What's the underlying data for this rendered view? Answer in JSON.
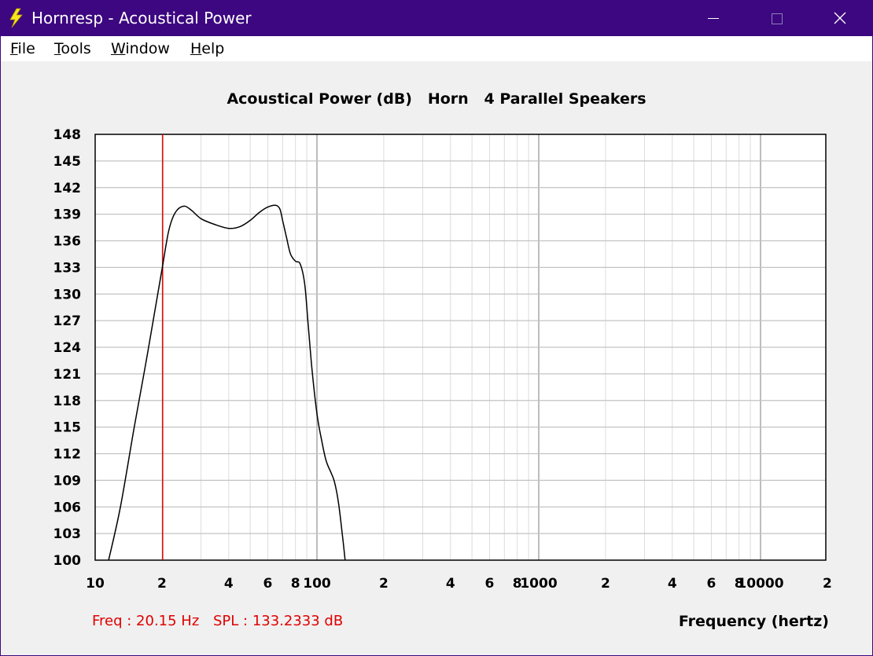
{
  "window": {
    "title": "Hornresp - Acoustical Power",
    "icon": "lightning-bolt-icon",
    "controls": [
      "minimize-icon",
      "maximize-icon",
      "close-icon"
    ]
  },
  "menu": [
    {
      "accel": "F",
      "rest": "ile"
    },
    {
      "accel": "T",
      "rest": "ools"
    },
    {
      "accel": "W",
      "rest": "indow"
    },
    {
      "accel": "H",
      "rest": "elp"
    }
  ],
  "status": {
    "freq_readout": "Freq : 20.15 Hz",
    "spl_readout": "SPL : 133.2333 dB"
  },
  "colors": {
    "titlebar": "#3c0780",
    "plot_bg": "#ffffff",
    "grid": "#c8c8c8",
    "curve": "#000000",
    "marker": "#e00000",
    "readout": "#e00000"
  },
  "chart_data": {
    "type": "line",
    "title": "Acoustical Power (dB)   Horn   4 Parallel Speakers",
    "xlabel": "Frequency (hertz)",
    "ylabel": "",
    "x_scale": "log",
    "xlim": [
      10,
      20000
    ],
    "ylim": [
      100,
      148
    ],
    "grid": true,
    "y_ticks": [
      100,
      103,
      106,
      109,
      112,
      115,
      118,
      121,
      124,
      127,
      130,
      133,
      136,
      139,
      142,
      145,
      148
    ],
    "x_ticks": [
      {
        "value": 10,
        "label": "10"
      },
      {
        "value": 20,
        "label": "2"
      },
      {
        "value": 40,
        "label": "4"
      },
      {
        "value": 60,
        "label": "6"
      },
      {
        "value": 80,
        "label": "8"
      },
      {
        "value": 100,
        "label": "100"
      },
      {
        "value": 200,
        "label": "2"
      },
      {
        "value": 400,
        "label": "4"
      },
      {
        "value": 600,
        "label": "6"
      },
      {
        "value": 800,
        "label": "8"
      },
      {
        "value": 1000,
        "label": "1000"
      },
      {
        "value": 2000,
        "label": "2"
      },
      {
        "value": 4000,
        "label": "4"
      },
      {
        "value": 6000,
        "label": "6"
      },
      {
        "value": 8000,
        "label": "8"
      },
      {
        "value": 10000,
        "label": "10000"
      },
      {
        "value": 20000,
        "label": "2"
      }
    ],
    "marker_x": 20.15,
    "series": [
      {
        "x": [
          11.5,
          13,
          15,
          17,
          19,
          20.15,
          21.5,
          23,
          25,
          27,
          30,
          35,
          40,
          45,
          50,
          55,
          60,
          65,
          68,
          70,
          73,
          76,
          80,
          84,
          88,
          91,
          95,
          100,
          105,
          110,
          116,
          120,
          125,
          130,
          134
        ],
        "y": [
          100,
          106,
          115,
          122.5,
          129.5,
          133.2,
          137.2,
          139.2,
          139.9,
          139.5,
          138.5,
          137.8,
          137.4,
          137.6,
          138.3,
          139.2,
          139.8,
          140.0,
          139.6,
          138.3,
          136.3,
          134.5,
          133.7,
          133.4,
          131.2,
          127,
          121.5,
          116.5,
          113.5,
          111.2,
          109.8,
          108.8,
          106.5,
          103,
          100
        ]
      }
    ]
  }
}
